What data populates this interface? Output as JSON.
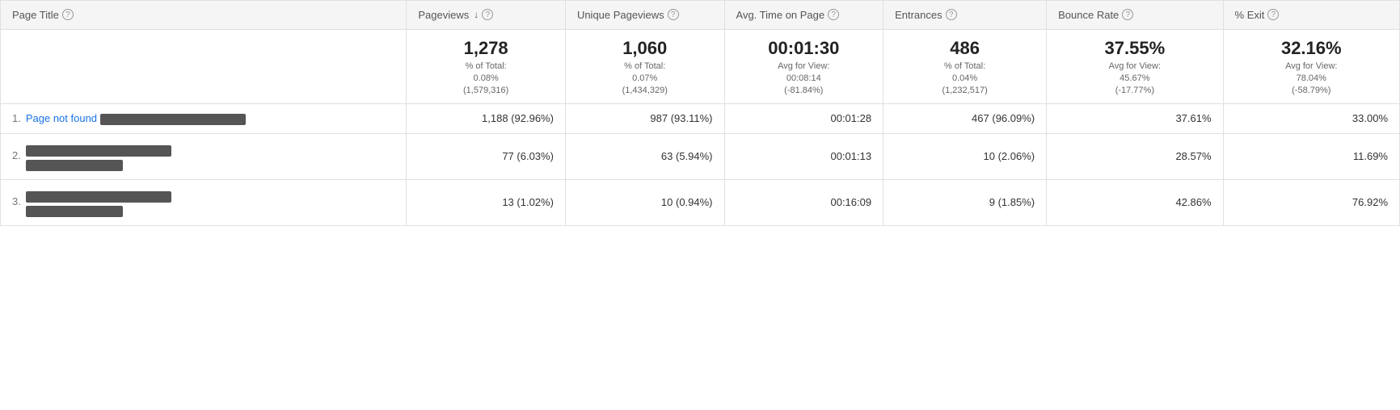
{
  "header": {
    "page_title_label": "Page Title",
    "pageviews_label": "Pageviews",
    "unique_pageviews_label": "Unique Pageviews",
    "avg_time_label": "Avg. Time on Page",
    "entrances_label": "Entrances",
    "bounce_rate_label": "Bounce Rate",
    "exit_label": "% Exit"
  },
  "summary": {
    "pageviews": "1,278",
    "pageviews_pct": "% of Total:",
    "pageviews_pct_val": "0.08%",
    "pageviews_total": "(1,579,316)",
    "unique_pageviews": "1,060",
    "unique_pct": "% of Total:",
    "unique_pct_val": "0.07%",
    "unique_total": "(1,434,329)",
    "avg_time": "00:01:30",
    "avg_time_label": "Avg for View:",
    "avg_time_view": "00:08:14",
    "avg_time_change": "(-81.84%)",
    "entrances": "486",
    "entrances_pct": "% of Total:",
    "entrances_pct_val": "0.04%",
    "entrances_total": "(1,232,517)",
    "bounce_rate": "37.55%",
    "bounce_avg_label": "Avg for View:",
    "bounce_avg": "45.67%",
    "bounce_change": "(-17.77%)",
    "exit_rate": "32.16%",
    "exit_avg_label": "Avg for View:",
    "exit_avg": "78.04%",
    "exit_change": "(-58.79%)"
  },
  "rows": [
    {
      "num": "1.",
      "page_title": "Page not found",
      "has_redacted": true,
      "redacted_type": "inline",
      "pageviews_main": "1,188",
      "pageviews_pct": "(92.96%)",
      "unique_main": "987",
      "unique_pct": "(93.11%)",
      "avg_time": "00:01:28",
      "entrances_main": "467",
      "entrances_pct": "(96.09%)",
      "bounce_rate": "37.61%",
      "exit_rate": "33.00%"
    },
    {
      "num": "2.",
      "page_title": "",
      "has_redacted": true,
      "redacted_type": "block2",
      "pageviews_main": "77",
      "pageviews_pct": "(6.03%)",
      "unique_main": "63",
      "unique_pct": "(5.94%)",
      "avg_time": "00:01:13",
      "entrances_main": "10",
      "entrances_pct": "(2.06%)",
      "bounce_rate": "28.57%",
      "exit_rate": "11.69%"
    },
    {
      "num": "3.",
      "page_title": "",
      "has_redacted": true,
      "redacted_type": "block2",
      "pageviews_main": "13",
      "pageviews_pct": "(1.02%)",
      "unique_main": "10",
      "unique_pct": "(0.94%)",
      "avg_time": "00:16:09",
      "entrances_main": "9",
      "entrances_pct": "(1.85%)",
      "bounce_rate": "42.86%",
      "exit_rate": "76.92%"
    }
  ]
}
